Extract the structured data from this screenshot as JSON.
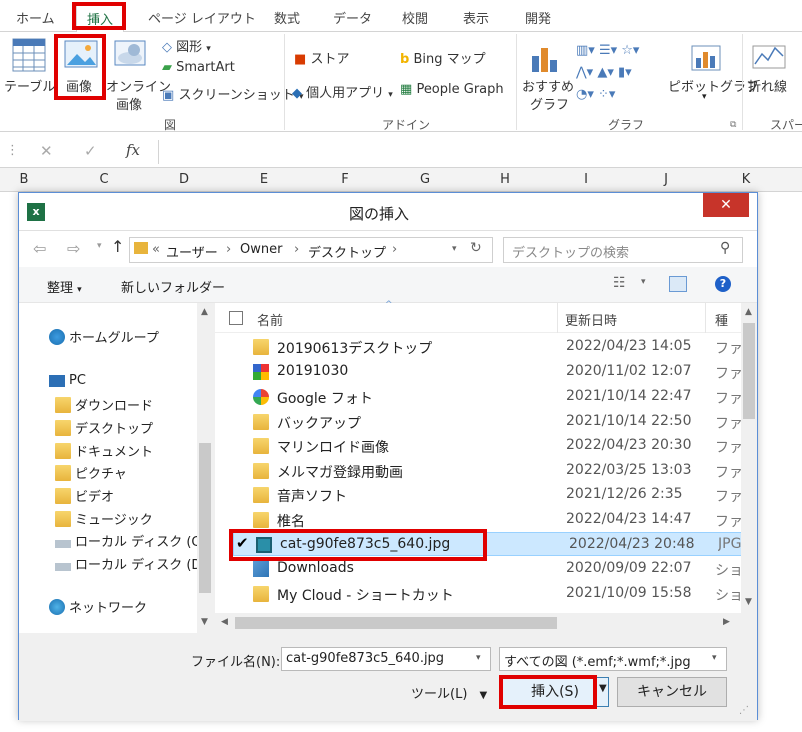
{
  "ribbon": {
    "tabs": [
      "ホーム",
      "挿入",
      "ページ レイアウト",
      "数式",
      "データ",
      "校閲",
      "表示",
      "開発"
    ],
    "active_tab": "挿入",
    "items": {
      "table": "テーブル",
      "picture": "画像",
      "online1": "オンライン",
      "online2": "画像",
      "shapes": "図形",
      "smartart": "SmartArt",
      "screenshot": "スクリーンショット",
      "store": "ストア",
      "myapps": "個人用アプリ",
      "bing": "Bing マップ",
      "people": "People Graph",
      "rec1": "おすすめ",
      "rec2": "グラフ",
      "pivot": "ピボットグラフ",
      "sparkline": "折れ線",
      "spark_more": "スパー"
    },
    "groups": {
      "illustrations": "図",
      "addins": "アドイン",
      "charts": "グラフ"
    }
  },
  "formula_bar": {
    "fx": "fx",
    "cancel": "✕",
    "enter": "✓",
    "more": "⋮"
  },
  "columns": [
    "B",
    "C",
    "D",
    "E",
    "F",
    "G",
    "H",
    "I",
    "J",
    "K"
  ],
  "dialog": {
    "title": "図の挿入",
    "close": "✕",
    "breadcrumb": {
      "sep": "«",
      "items": [
        "ユーザー",
        "Owner",
        "デスクトップ"
      ]
    },
    "search_placeholder": "デスクトップの検索",
    "toolbar": {
      "organize": "整理",
      "new_folder": "新しいフォルダー"
    },
    "nav": {
      "homegroup": "ホームグループ",
      "pc": "PC",
      "items": [
        "ダウンロード",
        "デスクトップ",
        "ドキュメント",
        "ピクチャ",
        "ビデオ",
        "ミュージック",
        "ローカル ディスク (C:",
        "ローカル ディスク (D:"
      ],
      "network": "ネットワーク"
    },
    "columns": {
      "name": "名前",
      "date": "更新日時",
      "type": "種"
    },
    "files": [
      {
        "name": "20190613デスクトップ",
        "date": "2022/04/23 14:05",
        "type": "ファ",
        "icon": "folder"
      },
      {
        "name": "20191030",
        "date": "2020/11/02 12:07",
        "type": "ファ",
        "icon": "app"
      },
      {
        "name": "Google フォト",
        "date": "2021/10/14 22:47",
        "type": "ファ",
        "icon": "google-photos"
      },
      {
        "name": "バックアップ",
        "date": "2021/10/14 22:50",
        "type": "ファ",
        "icon": "folder"
      },
      {
        "name": "マリンロイド画像",
        "date": "2022/04/23 20:30",
        "type": "ファ",
        "icon": "folder"
      },
      {
        "name": "メルマガ登録用動画",
        "date": "2022/03/25 13:03",
        "type": "ファ",
        "icon": "folder"
      },
      {
        "name": "音声ソフト",
        "date": "2021/12/26 2:35",
        "type": "ファ",
        "icon": "folder"
      },
      {
        "name": "椎名",
        "date": "2022/04/23 14:47",
        "type": "ファ",
        "icon": "folder"
      },
      {
        "name": "cat-g90fe873c5_640.jpg",
        "date": "2022/04/23 20:48",
        "type": "JPG",
        "icon": "image",
        "selected": true
      },
      {
        "name": "Downloads",
        "date": "2020/09/09 22:07",
        "type": "ショ",
        "icon": "shortcut"
      },
      {
        "name": "My Cloud - ショートカット",
        "date": "2021/10/09 15:58",
        "type": "ショ",
        "icon": "shortcut"
      }
    ],
    "filename_label": "ファイル名(N):",
    "filename_value": "cat-g90fe873c5_640.jpg",
    "filter_value": "すべての図 (*.emf;*.wmf;*.jpg",
    "tools_label": "ツール(L)",
    "insert_label": "挿入(S)",
    "cancel_label": "キャンセル"
  },
  "colors": {
    "accent": "#217346",
    "highlight": "#e00000",
    "selection": "#cce8ff",
    "close": "#c7342a"
  }
}
